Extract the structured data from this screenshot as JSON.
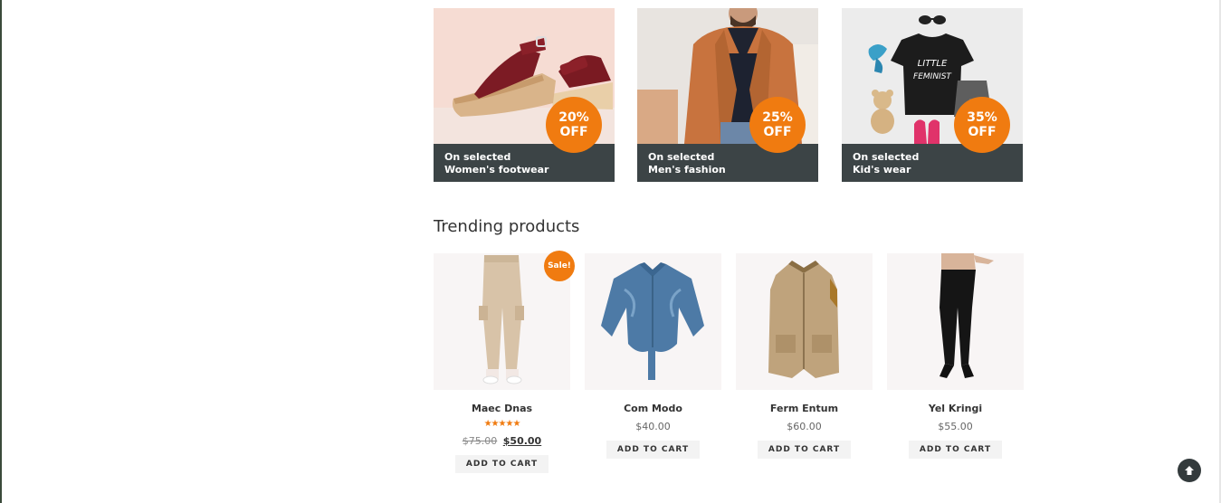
{
  "promos": [
    {
      "badge_pct": "20%",
      "badge_off": "OFF",
      "line1": "On selected",
      "line2": "Women's footwear"
    },
    {
      "badge_pct": "25%",
      "badge_off": "OFF",
      "line1": "On selected",
      "line2": "Men's fashion"
    },
    {
      "badge_pct": "35%",
      "badge_off": "OFF",
      "line1": "On selected",
      "line2": "Kid's wear"
    }
  ],
  "kids_shirt_text": {
    "line1": "LITTLE",
    "line2": "FEMINIST"
  },
  "trending": {
    "title": "Trending products",
    "sale_badge": "Sale!",
    "products": [
      {
        "name": "Maec Dnas",
        "rating": "★★★★★",
        "rating_value": 5,
        "old_price": "$75.00",
        "price": "$50.00",
        "button": "ADD TO CART"
      },
      {
        "name": "Com Modo",
        "price": "$40.00",
        "button": "ADD TO CART"
      },
      {
        "name": "Ferm Entum",
        "price": "$60.00",
        "button": "ADD TO CART"
      },
      {
        "name": "Yel Kringi",
        "price": "$55.00",
        "button": "ADD TO CART"
      }
    ]
  },
  "scroll_top_icon": "arrow-up-icon",
  "colors": {
    "accent": "#f07b10",
    "caption_bg": "#3c4446",
    "product_bg": "#f8f5f5"
  }
}
